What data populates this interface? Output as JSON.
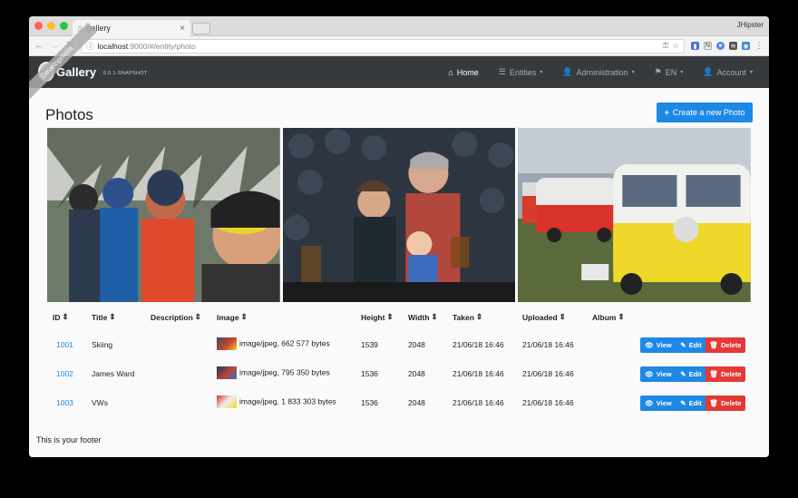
{
  "browser": {
    "tab_title": "gallery",
    "tab_close": "×",
    "profile_name": "JHipster",
    "url_host": "localhost",
    "url_rest": ":9000/#/entity/photo",
    "colors": {
      "close": "#ff5f57",
      "minimize": "#febc2e",
      "maximize": "#28c840"
    }
  },
  "navbar": {
    "brand": "Gallery",
    "version": "0.0.1-SNAPSHOT",
    "ribbon": "Development",
    "items": [
      {
        "label": "Home",
        "icon": "home-icon",
        "caret": ""
      },
      {
        "label": "Entities",
        "icon": "list-icon",
        "caret": "▾"
      },
      {
        "label": "Administration",
        "icon": "user-plus-icon",
        "caret": "▾"
      },
      {
        "label": "EN",
        "icon": "flag-icon",
        "caret": "▾"
      },
      {
        "label": "Account",
        "icon": "user-icon",
        "caret": "▾"
      }
    ]
  },
  "page": {
    "title": "Photos",
    "create_button": "Create a new Photo"
  },
  "table": {
    "headers": [
      "ID",
      "Title",
      "Description",
      "Image",
      "Height",
      "Width",
      "Taken",
      "Uploaded",
      "Album"
    ],
    "sort_glyph": "⇕",
    "rows": [
      {
        "id": "1001",
        "title": "Skiing",
        "description": "",
        "image": "image/jpeg, 662 577 bytes",
        "height": "1539",
        "width": "2048",
        "taken": "21/06/18 16:46",
        "uploaded": "21/06/18 16:46",
        "album": ""
      },
      {
        "id": "1002",
        "title": "James Ward",
        "description": "",
        "image": "image/jpeg, 795 350 bytes",
        "height": "1536",
        "width": "2048",
        "taken": "21/06/18 16:46",
        "uploaded": "21/06/18 16:46",
        "album": ""
      },
      {
        "id": "1003",
        "title": "VWs",
        "description": "",
        "image": "image/jpeg, 1 833 303 bytes",
        "height": "1536",
        "width": "2048",
        "taken": "21/06/18 16:46",
        "uploaded": "21/06/18 16:46",
        "album": ""
      }
    ],
    "actions": {
      "view": "View",
      "edit": "Edit",
      "delete": "Delete"
    }
  },
  "footer": "This is your footer"
}
